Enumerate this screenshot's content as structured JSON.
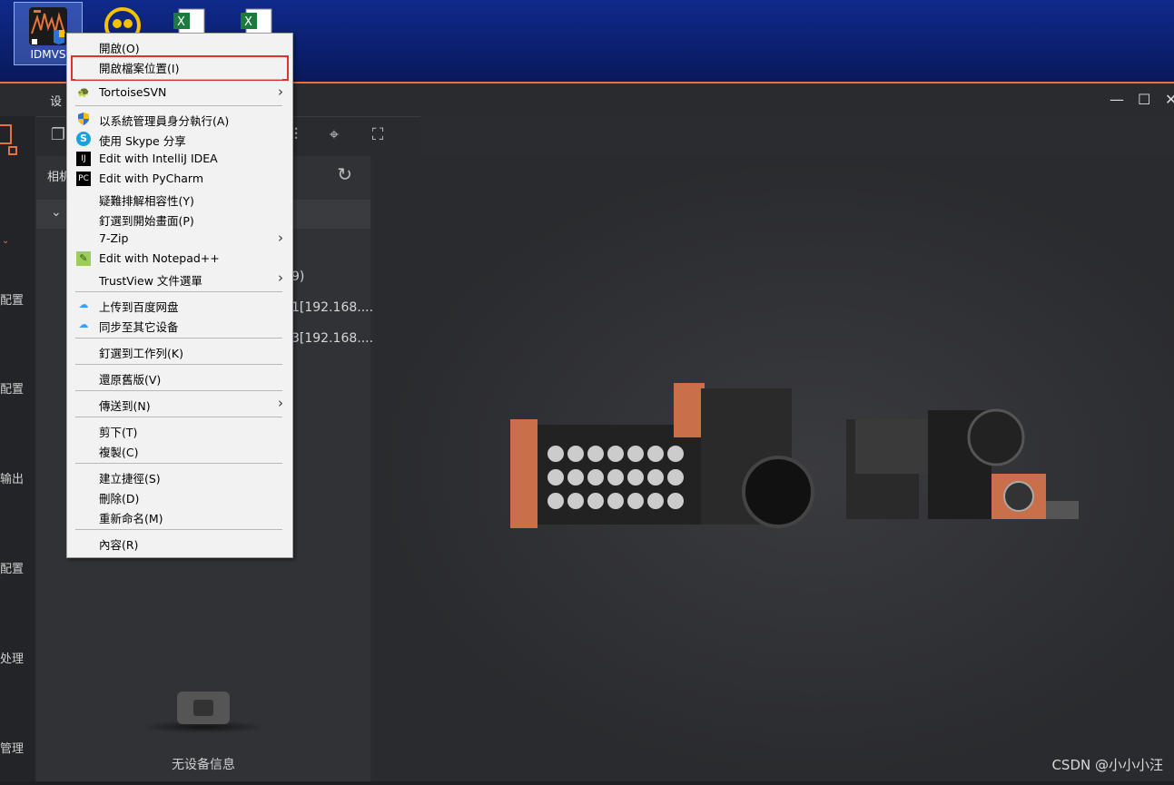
{
  "desktop": {
    "icons": [
      {
        "label": "IDMVS",
        "icon": "idmvs-app-icon"
      },
      {
        "label": "",
        "icon": "yellow-app-icon"
      },
      {
        "label": "",
        "icon": "excel-file-icon"
      },
      {
        "label": "",
        "icon": "excel-file-icon"
      }
    ]
  },
  "app": {
    "toolbar_label": "设",
    "panel_title": "相机",
    "device_lines": [
      "9)",
      "1[192.168....",
      "3[192.168...."
    ],
    "empty_state": "无设备信息",
    "rail": [
      "配置",
      "配置",
      "输出",
      "配置",
      "处理",
      "管理"
    ]
  },
  "menu": {
    "items": [
      {
        "label": "開啟(O)",
        "icon": "",
        "arrow": false
      },
      {
        "label": "開啟檔案位置(I)",
        "icon": "",
        "arrow": false
      },
      {
        "label": "TortoiseSVN",
        "icon": "tortoisesvn-icon",
        "arrow": true
      },
      {
        "label": "以系統管理員身分執行(A)",
        "icon": "uac-shield-icon",
        "arrow": false
      },
      {
        "label": "使用 Skype 分享",
        "icon": "skype-icon",
        "arrow": false
      },
      {
        "label": "Edit with IntelliJ IDEA",
        "icon": "intellij-icon",
        "arrow": false
      },
      {
        "label": "Edit with PyCharm",
        "icon": "pycharm-icon",
        "arrow": false
      },
      {
        "label": "疑難排解相容性(Y)",
        "icon": "",
        "arrow": false
      },
      {
        "label": "釘選到開始畫面(P)",
        "icon": "",
        "arrow": false
      },
      {
        "label": "7-Zip",
        "icon": "",
        "arrow": true
      },
      {
        "label": "Edit with Notepad++",
        "icon": "notepadpp-icon",
        "arrow": false
      },
      {
        "label": "TrustView 文件選單",
        "icon": "",
        "arrow": true
      },
      {
        "label": "上传到百度网盘",
        "icon": "baidu-netdisk-icon",
        "arrow": false
      },
      {
        "label": "同步至其它设备",
        "icon": "baidu-netdisk-icon",
        "arrow": false
      },
      {
        "label": "釘選到工作列(K)",
        "icon": "",
        "arrow": false
      },
      {
        "label": "還原舊版(V)",
        "icon": "",
        "arrow": false
      },
      {
        "label": "傳送到(N)",
        "icon": "",
        "arrow": true
      },
      {
        "label": "剪下(T)",
        "icon": "",
        "arrow": false
      },
      {
        "label": "複製(C)",
        "icon": "",
        "arrow": false
      },
      {
        "label": "建立捷徑(S)",
        "icon": "",
        "arrow": false
      },
      {
        "label": "刪除(D)",
        "icon": "",
        "arrow": false
      },
      {
        "label": "重新命名(M)",
        "icon": "",
        "arrow": false
      },
      {
        "label": "內容(R)",
        "icon": "",
        "arrow": false
      }
    ]
  },
  "watermark": "CSDN @小小小汪",
  "colors": {
    "accent": "#e8733a",
    "highlight": "#e03030",
    "menu_bg": "#f2f2f2"
  }
}
